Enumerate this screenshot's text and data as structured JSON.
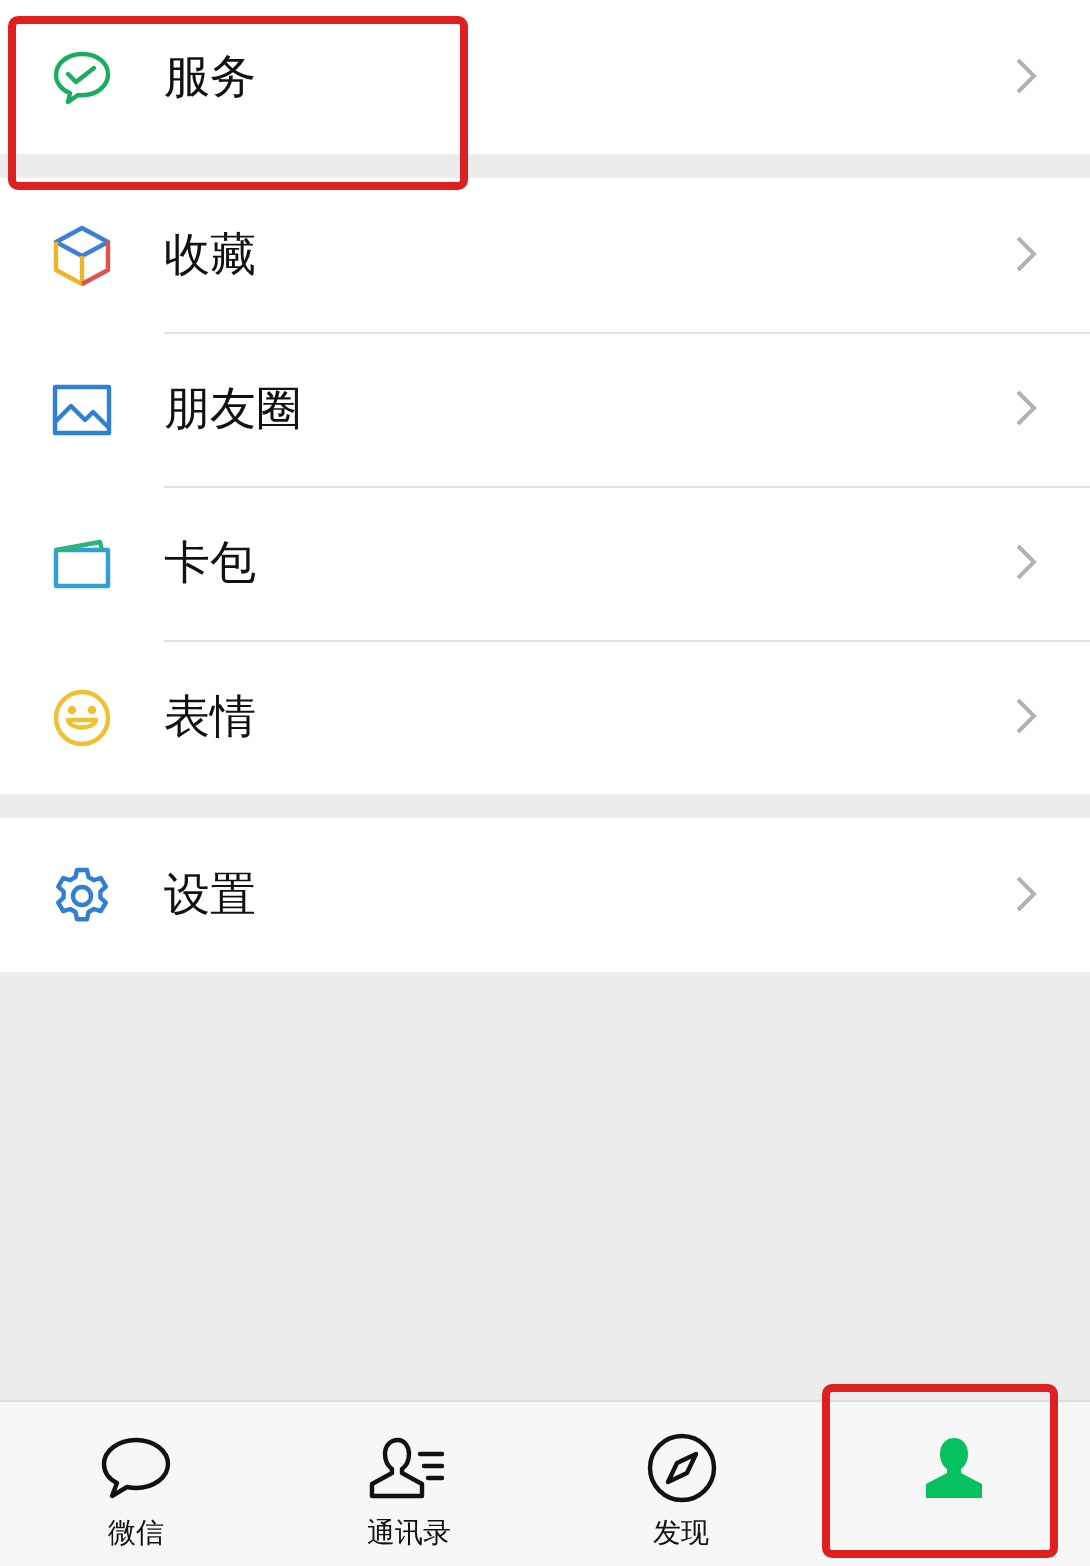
{
  "groups": [
    {
      "items": [
        {
          "kind": "service",
          "label": "服务",
          "highlighted": true
        }
      ]
    },
    {
      "items": [
        {
          "kind": "favorites",
          "label": "收藏",
          "highlighted": false
        },
        {
          "kind": "moments",
          "label": "朋友圈",
          "highlighted": false
        },
        {
          "kind": "cards",
          "label": "卡包",
          "highlighted": false
        },
        {
          "kind": "stickers",
          "label": "表情",
          "highlighted": false
        }
      ]
    },
    {
      "items": [
        {
          "kind": "settings",
          "label": "设置",
          "highlighted": false
        }
      ]
    }
  ],
  "tabs": [
    {
      "kind": "chats",
      "label": "微信",
      "selected": false,
      "highlighted": false
    },
    {
      "kind": "contacts",
      "label": "通讯录",
      "selected": false,
      "highlighted": false
    },
    {
      "kind": "discover",
      "label": "发现",
      "selected": false,
      "highlighted": false
    },
    {
      "kind": "me",
      "selected": true,
      "highlighted": true
    }
  ]
}
